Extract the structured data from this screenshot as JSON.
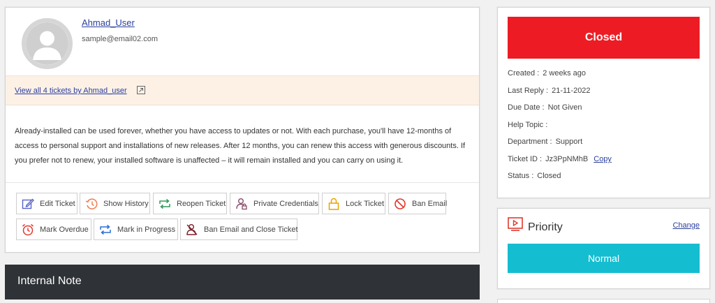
{
  "user": {
    "name": "Ahmad_User",
    "email": "sample@email02.com",
    "tickets_link": "View all 4 tickets by Ahmad_user"
  },
  "ticket": {
    "body": "Already-installed can be used forever, whether you have access to updates or not. With each purchase, you'll have 12-months of access to personal support and installations of new releases. After 12 months, you can renew this access with generous discounts. If you prefer not to renew, your installed software is unaffected – it will remain installed and you can carry on using it."
  },
  "actions": {
    "edit": "Edit Ticket",
    "history": "Show History",
    "reopen": "Reopen Ticket",
    "credentials": "Private Credentials",
    "lock": "Lock Ticket",
    "ban_email": "Ban Email",
    "overdue": "Mark Overdue",
    "in_progress": "Mark in Progress",
    "ban_close": "Ban Email and Close Ticket"
  },
  "note": {
    "title": "Internal Note"
  },
  "status": {
    "banner": "Closed",
    "created_label": "Created :",
    "created_value": "2 weeks ago",
    "last_reply_label": "Last Reply :",
    "last_reply_value": "21-11-2022",
    "due_label": "Due Date :",
    "due_value": "Not Given",
    "help_label": "Help Topic :",
    "help_value": "",
    "dept_label": "Department :",
    "dept_value": "Support",
    "id_label": "Ticket ID :",
    "id_value": "Jz3PpNMhB",
    "copy_label": "Copy",
    "status_label": "Status :",
    "status_value": "Closed"
  },
  "priority": {
    "title": "Priority",
    "change_label": "Change",
    "value": "Normal"
  },
  "colors": {
    "closed": "#ed1c24",
    "normal": "#15bdd0",
    "link": "#2b3f9e",
    "note_bar": "#2f3236"
  },
  "icons": [
    "user-avatar-icon",
    "external-link-icon",
    "edit-icon",
    "history-icon",
    "reopen-icon",
    "credentials-icon",
    "lock-icon",
    "ban-icon",
    "alarm-clock-icon",
    "progress-icon",
    "ban-user-icon",
    "priority-icon"
  ]
}
